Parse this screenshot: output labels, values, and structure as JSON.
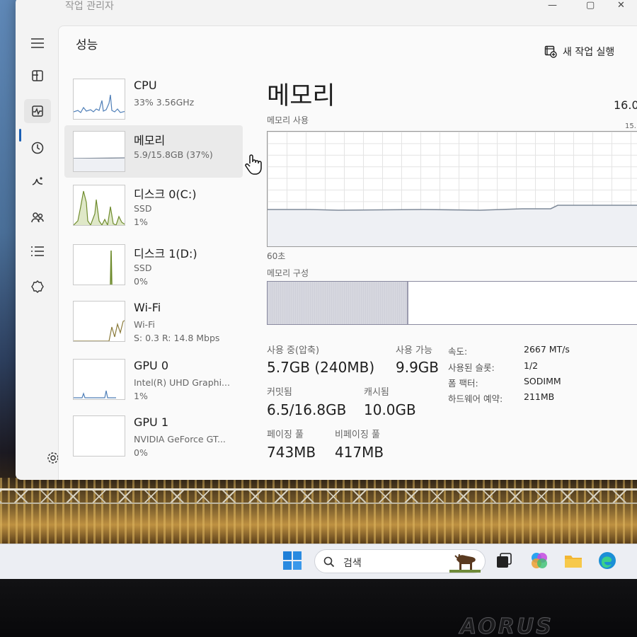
{
  "window": {
    "title": "작업 관리자",
    "controls": [
      "—",
      "▢",
      "✕"
    ]
  },
  "nav": {
    "items": [
      {
        "icon": "hamburger-menu-icon"
      },
      {
        "icon": "processes-icon"
      },
      {
        "icon": "performance-icon"
      },
      {
        "icon": "app-history-icon"
      },
      {
        "icon": "startup-apps-icon"
      },
      {
        "icon": "users-icon"
      },
      {
        "icon": "details-icon"
      },
      {
        "icon": "services-icon"
      }
    ],
    "settings_icon": "gear-icon"
  },
  "page": {
    "title": "성능",
    "run_task_label": "새 작업 실행"
  },
  "resources": [
    {
      "name": "CPU",
      "line2": "33% 3.56GHz",
      "line3": ""
    },
    {
      "name": "메모리",
      "line2": "5.9/15.8GB (37%)",
      "line3": ""
    },
    {
      "name": "디스크 0(C:)",
      "line2": "SSD",
      "line3": "1%"
    },
    {
      "name": "디스크 1(D:)",
      "line2": "SSD",
      "line3": "0%"
    },
    {
      "name": "Wi-Fi",
      "line2": "Wi-Fi",
      "line3": "S: 0.3 R: 14.8 Mbps"
    },
    {
      "name": "GPU 0",
      "line2": "Intel(R) UHD Graphi...",
      "line3": "1%"
    },
    {
      "name": "GPU 1",
      "line2": "NVIDIA GeForce GT...",
      "line3": "0%"
    }
  ],
  "detail": {
    "title": "메모리",
    "total": "16.0",
    "graph_max": "15.",
    "usage_label": "메모리 사용",
    "time_label": "60초",
    "composition_label": "메모리 구성",
    "composition_used_fraction": 0.37,
    "stats": {
      "in_use_label": "사용 중(압축)",
      "in_use_value": "5.7GB (240MB)",
      "available_label": "사용 가능",
      "available_value": "9.9GB",
      "committed_label": "커밋됨",
      "committed_value": "6.5/16.8GB",
      "cached_label": "캐시됨",
      "cached_value": "10.0GB",
      "paged_label": "페이징 풀",
      "paged_value": "743MB",
      "nonpaged_label": "비페이징 풀",
      "nonpaged_value": "417MB"
    },
    "specs": [
      {
        "key": "속도:",
        "value": "2667 MT/s"
      },
      {
        "key": "사용된 슬롯:",
        "value": "1/2"
      },
      {
        "key": "폼 팩터:",
        "value": "SODIMM"
      },
      {
        "key": "하드웨어 예약:",
        "value": "211MB"
      }
    ]
  },
  "taskbar": {
    "search_placeholder": "검색",
    "apps": [
      "task-view-icon",
      "copilot-icon",
      "file-explorer-icon",
      "edge-icon"
    ]
  },
  "bezel": {
    "brand": "AORUS"
  },
  "colors": {
    "accent": "#1a5fb4",
    "graph_line": "#7f8a99",
    "cpu_line": "#4f7fb8",
    "disk_line": "#6f8c2e"
  }
}
